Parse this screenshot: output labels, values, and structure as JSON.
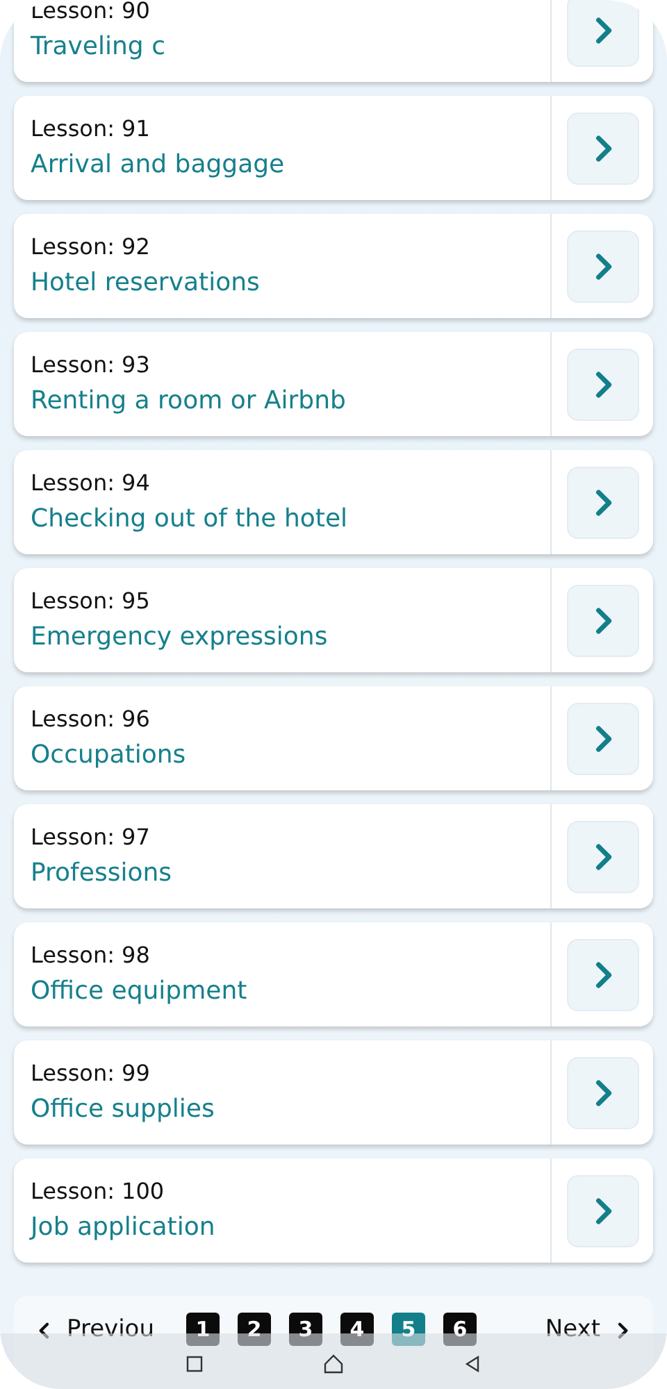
{
  "lessons": [
    {
      "label": "Lesson: 90",
      "title": "Traveling c"
    },
    {
      "label": "Lesson: 91",
      "title": "Arrival and baggage"
    },
    {
      "label": "Lesson: 92",
      "title": "Hotel reservations"
    },
    {
      "label": "Lesson: 93",
      "title": "Renting a room or Airbnb"
    },
    {
      "label": "Lesson: 94",
      "title": "Checking out of the hotel"
    },
    {
      "label": "Lesson: 95",
      "title": "Emergency expressions"
    },
    {
      "label": "Lesson: 96",
      "title": "Occupations"
    },
    {
      "label": "Lesson: 97",
      "title": "Professions"
    },
    {
      "label": "Lesson: 98",
      "title": "Office equipment"
    },
    {
      "label": "Lesson: 99",
      "title": "Office supplies"
    },
    {
      "label": "Lesson: 100",
      "title": "Job application"
    }
  ],
  "pagination": {
    "previous": "Previou",
    "next": "Next",
    "pages": [
      {
        "label": "1",
        "selected": false
      },
      {
        "label": "2",
        "selected": false
      },
      {
        "label": "3",
        "selected": false
      },
      {
        "label": "4",
        "selected": false
      },
      {
        "label": "5",
        "selected": true
      },
      {
        "label": "6",
        "selected": false
      }
    ]
  }
}
